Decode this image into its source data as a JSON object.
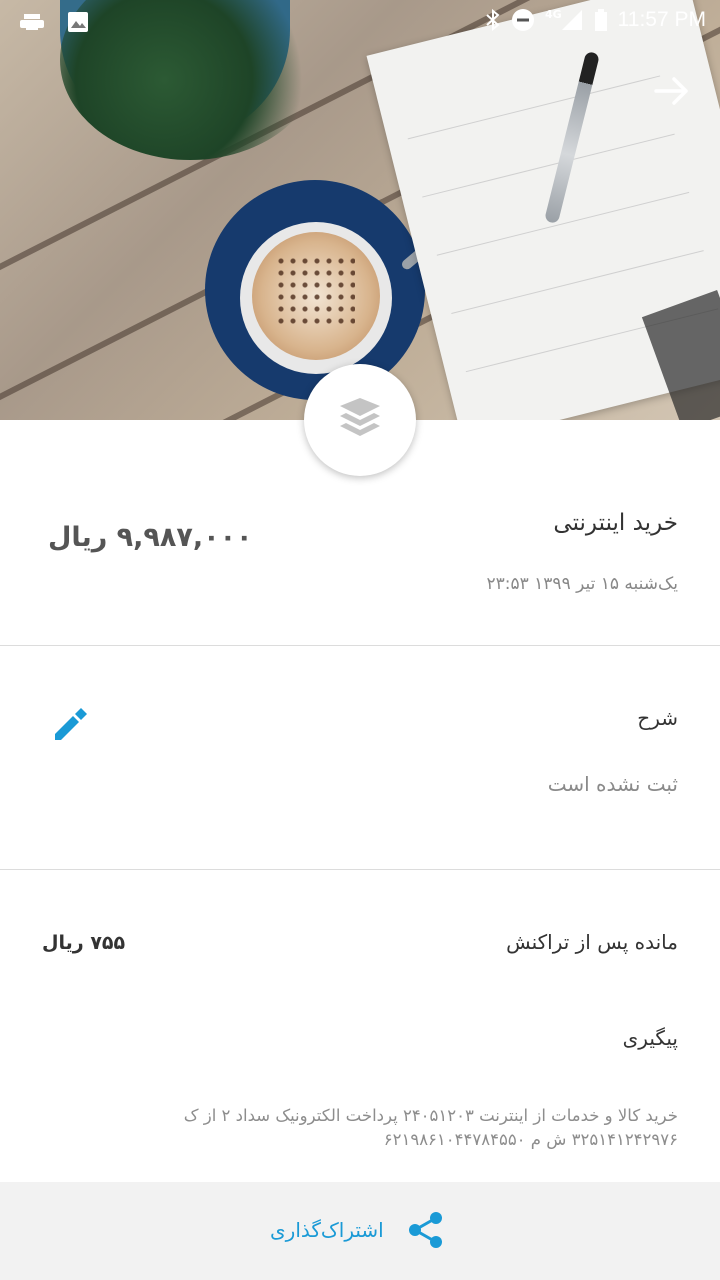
{
  "status_bar": {
    "time": "11:57 PM",
    "network": "4G",
    "icons": [
      "printer-icon",
      "image-icon",
      "bluetooth-icon",
      "do-not-disturb-icon",
      "signal-icon",
      "battery-icon"
    ]
  },
  "header": {
    "back_icon": "arrow-right-icon"
  },
  "badge": {
    "icon": "layers-icon"
  },
  "transaction": {
    "title": "خرید اینترنتی",
    "amount": "۹,۹۸۷,۰۰۰ ریال",
    "datetime": "یک‌شنبه ۱۵ تیر ۱۳۹۹  ۲۳:۵۳"
  },
  "description": {
    "label": "شرح",
    "value": "ثبت نشده است",
    "edit_icon": "pencil-icon"
  },
  "balance": {
    "label": "مانده پس از تراکنش",
    "value": "۷۵۵ ریال"
  },
  "tracking": {
    "label": "پیگیری",
    "text": "خرید کالا و خدمات از اینترنت ۲۴۰۵۱۲۰۳ پرداخت الکترونیک سداد ۲ از ک ۳۲۵۱۴۱۲۴۲۹۷۶ ش م ۶۲۱۹۸۶۱۰۴۴۷۸۴۵۵۰"
  },
  "share": {
    "label": "اشتراک‌گذاری",
    "icon": "share-icon"
  },
  "colors": {
    "accent": "#1a9ad6",
    "bottom_bar": "#f2f2f2",
    "divider": "#dcdcdc"
  }
}
